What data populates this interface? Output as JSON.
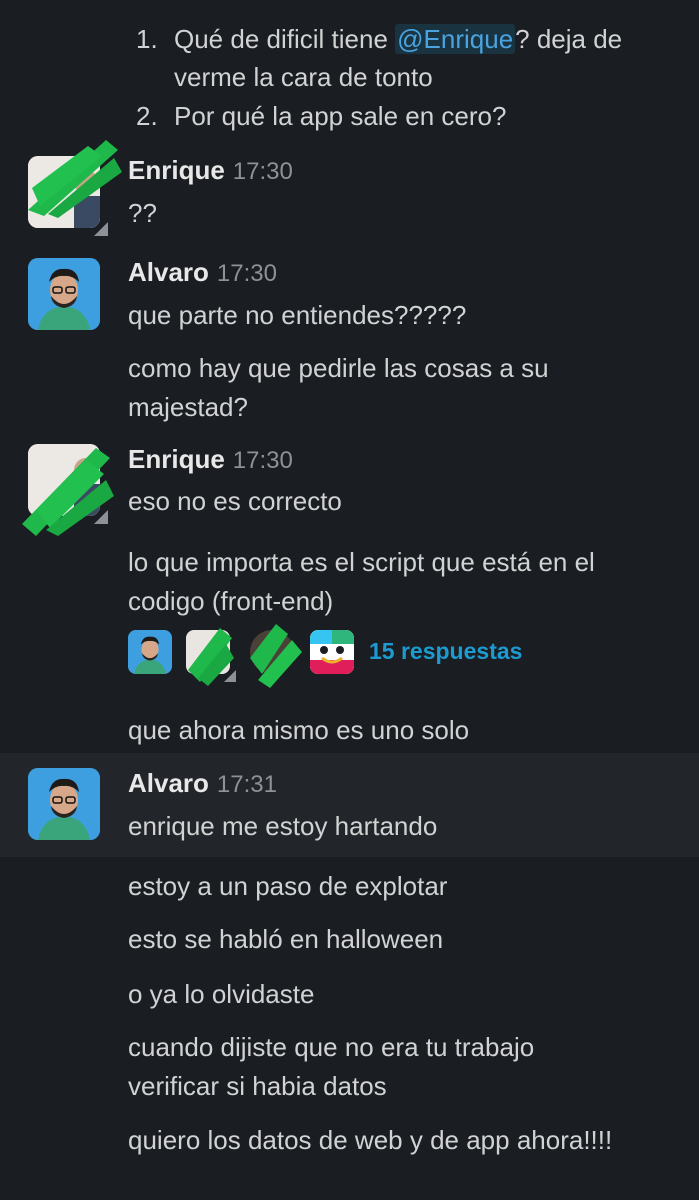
{
  "list_items": [
    {
      "num": "1.",
      "before": "Qué de dificil tiene ",
      "mention": "@Enrique",
      "after": "? deja de",
      "line2": "verme la cara de tonto"
    },
    {
      "num": "2.",
      "text": "Por qué la app sale en cero?"
    }
  ],
  "msg1": {
    "author": "Enrique",
    "time": "17:30",
    "text": "??"
  },
  "msg2": {
    "author": "Alvaro",
    "time": "17:30",
    "line1": "que parte no entiendes?????",
    "line2a": "como hay que pedirle las cosas a su",
    "line2b": "majestad?"
  },
  "msg3": {
    "author": "Enrique",
    "time": "17:30",
    "line1": "eso no es correcto",
    "line2a": "lo que importa es el script que está en el",
    "line2b": "codigo (front-end)",
    "replies": "15 respuestas",
    "line3": "que ahora mismo es uno solo"
  },
  "msg4": {
    "author": "Alvaro",
    "time": "17:31",
    "line1": "enrique me estoy hartando",
    "line2": "estoy a un paso de explotar",
    "line3": "esto se habló en halloween",
    "line4": "o ya lo olvidaste",
    "line5a": "cuando dijiste que no era tu trabajo",
    "line5b": "verificar si habia datos",
    "line6": "quiero los datos de web y de app ahora!!!!"
  },
  "colors": {
    "background": "#1a1d21",
    "highlight": "#222529",
    "link": "#1d9bd1",
    "redaction": "#1fb84a"
  }
}
